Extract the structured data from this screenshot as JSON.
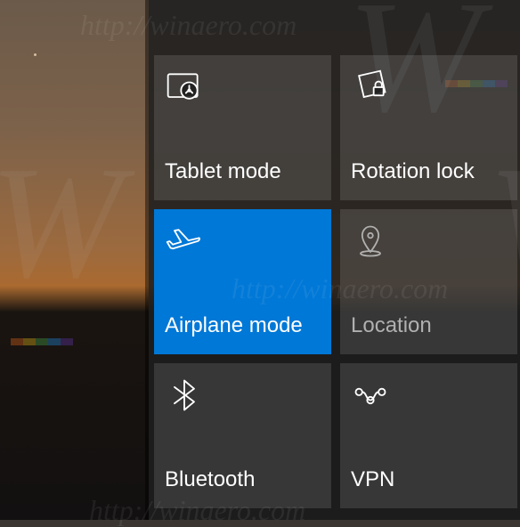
{
  "watermark": "http://winaero.com",
  "tiles": [
    {
      "id": "tablet-mode",
      "label": "Tablet mode",
      "active": false,
      "dim": false
    },
    {
      "id": "rotation-lock",
      "label": "Rotation lock",
      "active": false,
      "dim": false
    },
    {
      "id": "airplane-mode",
      "label": "Airplane mode",
      "active": true,
      "dim": false
    },
    {
      "id": "location",
      "label": "Location",
      "active": false,
      "dim": true
    },
    {
      "id": "bluetooth",
      "label": "Bluetooth",
      "active": false,
      "dim": false
    },
    {
      "id": "vpn",
      "label": "VPN",
      "active": false,
      "dim": false
    }
  ]
}
